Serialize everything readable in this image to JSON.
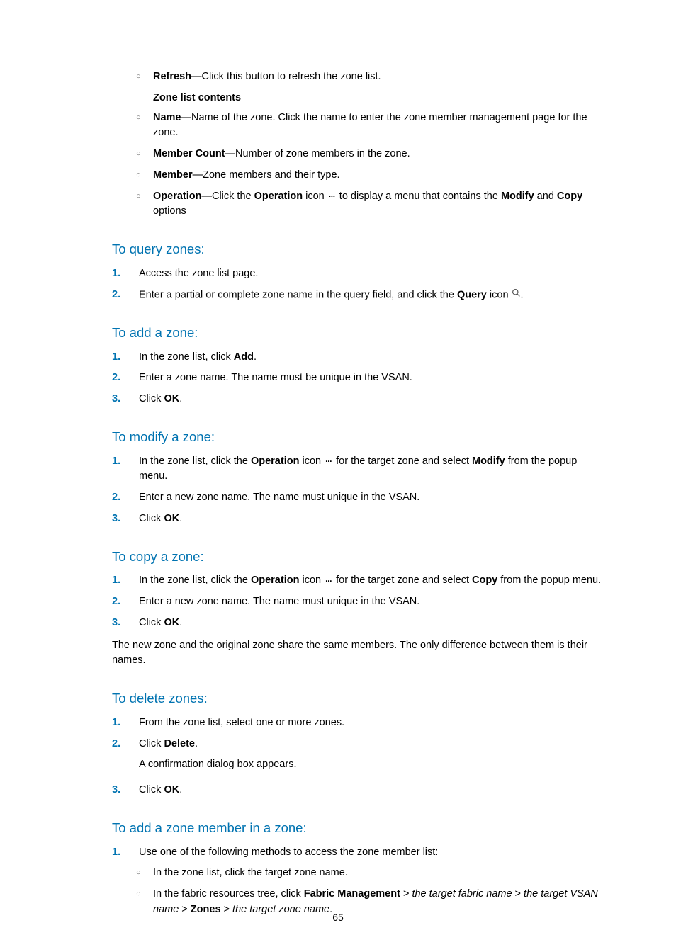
{
  "top_bullets": {
    "refresh_label": "Refresh",
    "refresh_text": "—Click this button to refresh the zone list.",
    "zone_list_contents_heading": "Zone list contents",
    "name_label": "Name",
    "name_text": "—Name of the zone. Click the name to enter the zone member management page for the zone.",
    "member_count_label": "Member Count",
    "member_count_text": "—Number of zone members in the zone.",
    "member_label": "Member",
    "member_text": "—Zone members and their type.",
    "operation_label": "Operation",
    "operation_text_1": "—Click the ",
    "operation_bold": "Operation",
    "operation_text_2": " icon ",
    "operation_text_3": " to display a menu that contains the ",
    "modify_bold": "Modify",
    "operation_text_4": " and ",
    "copy_bold": "Copy",
    "operation_text_5": " options"
  },
  "query_zones": {
    "heading": "To query zones:",
    "step1": "Access the zone list page.",
    "step2_a": "Enter a partial or complete zone name in the query field, and click the ",
    "step2_bold": "Query",
    "step2_b": " icon ",
    "step2_c": "."
  },
  "add_zone": {
    "heading": "To add a zone:",
    "step1_a": "In the zone list, click ",
    "step1_bold": "Add",
    "step1_b": ".",
    "step2": "Enter a zone name. The name must be unique in the VSAN.",
    "step3_a": "Click ",
    "step3_bold": "OK",
    "step3_b": "."
  },
  "modify_zone": {
    "heading": "To modify a zone:",
    "step1_a": "In the zone list, click the ",
    "step1_bold1": "Operation",
    "step1_b": " icon ",
    "step1_c": " for the target zone and select ",
    "step1_bold2": "Modify",
    "step1_d": " from the popup menu.",
    "step2": "Enter a new zone name. The name must unique in the VSAN.",
    "step3_a": "Click ",
    "step3_bold": "OK",
    "step3_b": "."
  },
  "copy_zone": {
    "heading": "To copy a zone:",
    "step1_a": "In the zone list, click the ",
    "step1_bold1": "Operation",
    "step1_b": " icon ",
    "step1_c": " for the target zone and select ",
    "step1_bold2": "Copy",
    "step1_d": " from the popup menu.",
    "step2": "Enter a new zone name. The name must unique in the VSAN.",
    "step3_a": "Click ",
    "step3_bold": "OK",
    "step3_b": ".",
    "para": "The new zone and the original zone share the same members. The only difference between them is their names."
  },
  "delete_zones": {
    "heading": "To delete zones:",
    "step1": "From the zone list, select one or more zones.",
    "step2_a": "Click ",
    "step2_bold": "Delete",
    "step2_b": ".",
    "step2_sub": "A confirmation dialog box appears.",
    "step3_a": "Click ",
    "step3_bold": "OK",
    "step3_b": "."
  },
  "add_member": {
    "heading": "To add a zone member in a zone:",
    "step1": "Use one of the following methods to access the zone member list:",
    "sub1": "In the zone list, click the target zone name.",
    "sub2_a": "In the fabric resources tree, click ",
    "sub2_bold1": "Fabric Management",
    "sub2_b": " > ",
    "sub2_it1": "the target fabric name",
    "sub2_c": " > ",
    "sub2_it2": "the target VSAN name",
    "sub2_d": " > ",
    "sub2_bold2": "Zones",
    "sub2_e": " > ",
    "sub2_it3": "the target zone name",
    "sub2_f": "."
  },
  "page_number": "65"
}
